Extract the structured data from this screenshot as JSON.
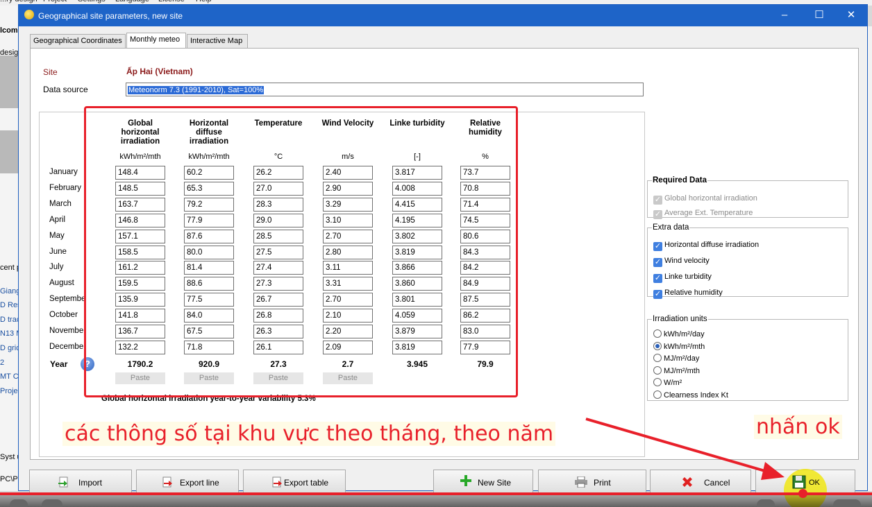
{
  "background": {
    "menu": [
      "...ry design",
      "Project",
      "Settings",
      "Language",
      "License",
      "Help"
    ],
    "left_texts": [
      "lcom",
      "design",
      "cent p",
      "Giang",
      "D Res",
      "D trac",
      "N13 M",
      "D grid",
      "2",
      "MT C",
      "Proje",
      "Syst u",
      "PC\\PV"
    ]
  },
  "dialog": {
    "title": "Geographical site parameters, new site",
    "window_buttons": [
      "–",
      "☐",
      "✕"
    ]
  },
  "tabs": [
    "Geographical Coordinates",
    "Monthly meteo",
    "Interactive Map"
  ],
  "site": {
    "label": "Site",
    "value": "Ấp Hai   (Vietnam)"
  },
  "data_source": {
    "label": "Data source",
    "value": "Meteonorm 7.3 (1991-2010), Sat=100%"
  },
  "table": {
    "columns": [
      {
        "header": "Global horizontal irradiation",
        "unit": "kWh/m²/mth"
      },
      {
        "header": "Horizontal diffuse irradiation",
        "unit": "kWh/m²/mth"
      },
      {
        "header": "Temperature",
        "unit": "°C"
      },
      {
        "header": "Wind Velocity",
        "unit": "m/s"
      },
      {
        "header": "Linke turbidity",
        "unit": "[-]"
      },
      {
        "header": "Relative humidity",
        "unit": "%"
      }
    ],
    "rows": [
      {
        "month": "January",
        "values": [
          "148.4",
          "60.2",
          "26.2",
          "2.40",
          "3.817",
          "73.7"
        ]
      },
      {
        "month": "February",
        "values": [
          "148.5",
          "65.3",
          "27.0",
          "2.90",
          "4.008",
          "70.8"
        ]
      },
      {
        "month": "March",
        "values": [
          "163.7",
          "79.2",
          "28.3",
          "3.29",
          "4.415",
          "71.4"
        ]
      },
      {
        "month": "April",
        "values": [
          "146.8",
          "77.9",
          "29.0",
          "3.10",
          "4.195",
          "74.5"
        ]
      },
      {
        "month": "May",
        "values": [
          "157.1",
          "87.6",
          "28.5",
          "2.70",
          "3.802",
          "80.6"
        ]
      },
      {
        "month": "June",
        "values": [
          "158.5",
          "80.0",
          "27.5",
          "2.80",
          "3.819",
          "84.3"
        ]
      },
      {
        "month": "July",
        "values": [
          "161.2",
          "81.4",
          "27.4",
          "3.11",
          "3.866",
          "84.2"
        ]
      },
      {
        "month": "August",
        "values": [
          "159.5",
          "88.6",
          "27.3",
          "3.31",
          "3.860",
          "84.9"
        ]
      },
      {
        "month": "Septembe",
        "values": [
          "135.9",
          "77.5",
          "26.7",
          "2.70",
          "3.801",
          "87.5"
        ]
      },
      {
        "month": "October",
        "values": [
          "141.8",
          "84.0",
          "26.8",
          "2.10",
          "4.059",
          "86.2"
        ]
      },
      {
        "month": "November",
        "values": [
          "136.7",
          "67.5",
          "26.3",
          "2.20",
          "3.879",
          "83.0"
        ]
      },
      {
        "month": "December",
        "values": [
          "132.2",
          "71.8",
          "26.1",
          "2.09",
          "3.819",
          "77.9"
        ]
      }
    ],
    "year_label": "Year",
    "year_values": [
      "1790.2",
      "920.9",
      "27.3",
      "2.7",
      "3.945",
      "79.9"
    ],
    "paste_label": "Paste",
    "variability": "Global horizontal irradiation year-to-year variability   5.3%"
  },
  "required_data": {
    "title": "Required Data",
    "items": [
      "Global horizontal irradiation",
      "Average Ext. Temperature"
    ]
  },
  "extra_data": {
    "title": "Extra data",
    "items": [
      "Horizontal diffuse irradiation",
      "Wind velocity",
      "Linke turbidity",
      "Relative humidity"
    ]
  },
  "irradiation_units": {
    "title": "Irradiation units",
    "options": [
      "kWh/m²/day",
      "kWh/m²/mth",
      "MJ/m²/day",
      "MJ/m²/mth",
      "W/m²",
      "Clearness Index Kt"
    ],
    "selected": "kWh/m²/mth"
  },
  "buttons": {
    "import": "Import",
    "export_line": "Export line",
    "export_table": "Export table",
    "new_site": "New Site",
    "print": "Print",
    "cancel": "Cancel",
    "ok": "OK"
  },
  "annotations": {
    "note": "các thông số tại khu vực theo tháng, theo năm",
    "press_ok": "nhấn ok"
  },
  "colors": {
    "titlebar": "#1e64c8",
    "annotation_red": "#e8202a",
    "site_label": "#8b1a1a"
  }
}
